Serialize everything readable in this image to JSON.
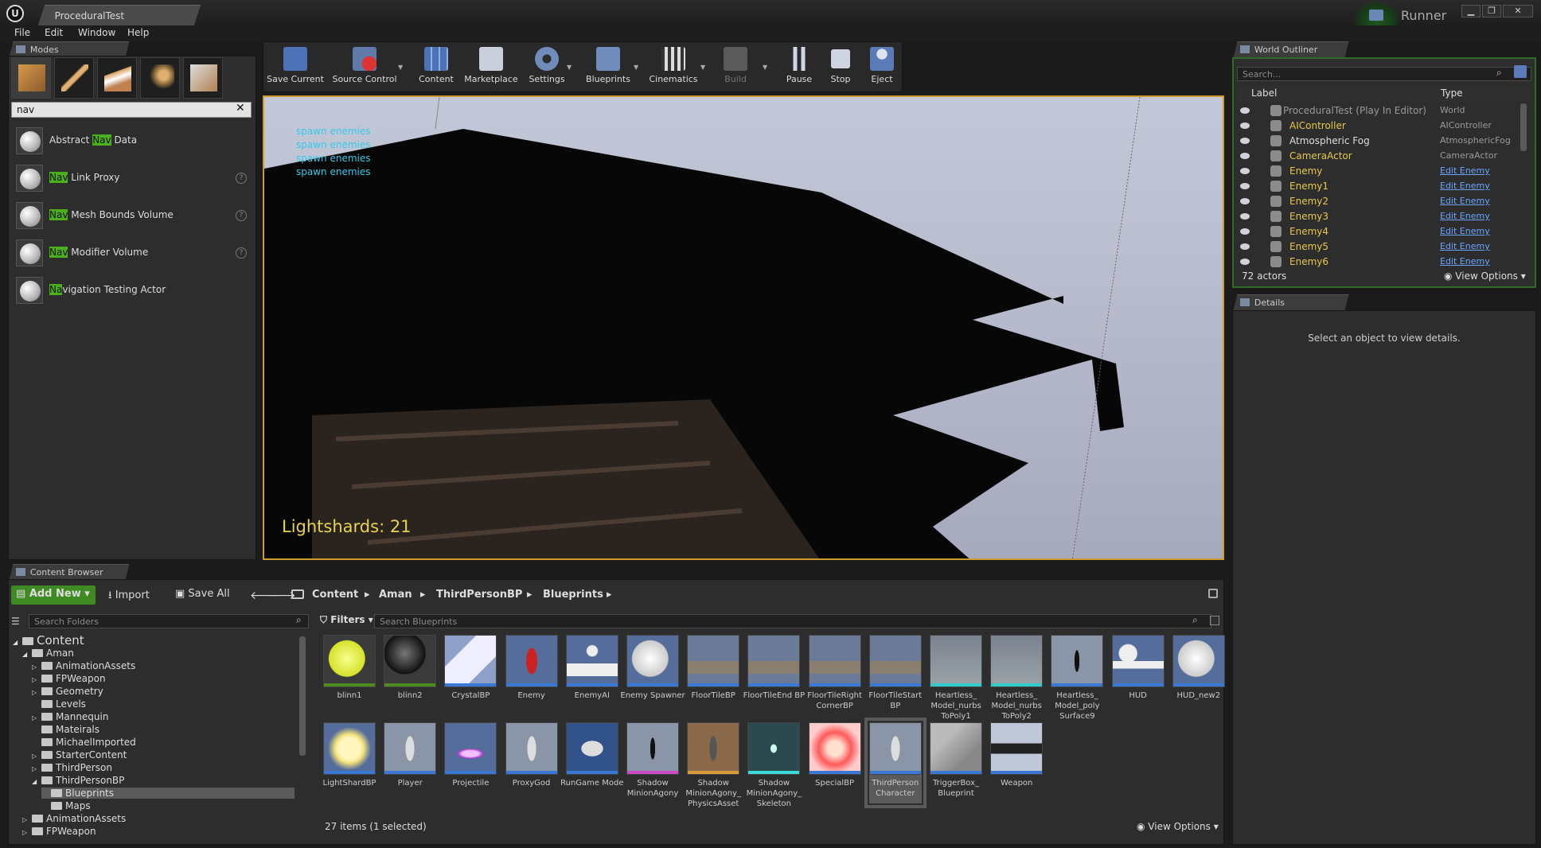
{
  "window": {
    "doc_tab": "ProceduralTest",
    "runner": "Runner",
    "min": "▁",
    "max": "❐",
    "close": "✕"
  },
  "menu": [
    "File",
    "Edit",
    "Window",
    "Help"
  ],
  "modes": {
    "tab": "Modes",
    "search": "nav",
    "actors": [
      {
        "prefix": "Abstract ",
        "hl": "Nav",
        "suffix": " Data",
        "help": false
      },
      {
        "prefix": "",
        "hl": "Nav",
        "suffix": " Link Proxy",
        "help": true
      },
      {
        "prefix": "",
        "hl": "Nav",
        "suffix": " Mesh Bounds Volume",
        "help": true
      },
      {
        "prefix": "",
        "hl": "Nav",
        "suffix": " Modifier Volume",
        "help": true
      },
      {
        "prefix": "",
        "hl": "Na",
        "suffix": "vigation Testing Actor",
        "help": false
      }
    ]
  },
  "toolbar": {
    "save_current": "Save Current",
    "source_control": "Source Control",
    "content": "Content",
    "marketplace": "Marketplace",
    "settings": "Settings",
    "blueprints": "Blueprints",
    "cinematics": "Cinematics",
    "build": "Build",
    "pause": "Pause",
    "stop": "Stop",
    "eject": "Eject"
  },
  "viewport": {
    "messages": [
      "spawn enemies",
      "spawn enemies",
      "spawn enemies",
      "spawn enemies"
    ],
    "hud": "Lightshards: 21"
  },
  "outliner": {
    "tab": "World Outliner",
    "search_placeholder": "Search...",
    "col_label": "Label",
    "col_type": "Type",
    "rows": [
      {
        "label": "ProceduralTest (Play In Editor)",
        "type": "World",
        "link": false,
        "dim": true
      },
      {
        "label": "AIController",
        "type": "AIController",
        "link": false,
        "dim": false
      },
      {
        "label": "Atmospheric Fog",
        "type": "AtmosphericFog",
        "link": false,
        "dim": false
      },
      {
        "label": "CameraActor",
        "type": "CameraActor",
        "link": false,
        "dim": false
      },
      {
        "label": "Enemy",
        "type": "Edit Enemy",
        "link": true,
        "dim": false
      },
      {
        "label": "Enemy1",
        "type": "Edit Enemy",
        "link": true,
        "dim": false
      },
      {
        "label": "Enemy2",
        "type": "Edit Enemy",
        "link": true,
        "dim": false
      },
      {
        "label": "Enemy3",
        "type": "Edit Enemy",
        "link": true,
        "dim": false
      },
      {
        "label": "Enemy4",
        "type": "Edit Enemy",
        "link": true,
        "dim": false
      },
      {
        "label": "Enemy5",
        "type": "Edit Enemy",
        "link": true,
        "dim": false
      },
      {
        "label": "Enemy6",
        "type": "Edit Enemy",
        "link": true,
        "dim": false
      }
    ],
    "count": "72 actors",
    "view_options": "View Options"
  },
  "details": {
    "tab": "Details",
    "empty": "Select an object to view details."
  },
  "content_browser": {
    "tab": "Content Browser",
    "add_new": "Add New",
    "import": "Import",
    "save_all": "Save All",
    "breadcrumbs": [
      "Content",
      "Aman",
      "ThirdPersonBP",
      "Blueprints"
    ],
    "search_folders": "Search Folders",
    "filters": "Filters",
    "search_assets": "Search Blueprints",
    "tree": [
      {
        "label": "Content",
        "depth": 0,
        "arrow": "◢"
      },
      {
        "label": "Aman",
        "depth": 1,
        "arrow": "◢"
      },
      {
        "label": "AnimationAssets",
        "depth": 2,
        "arrow": "▷"
      },
      {
        "label": "FPWeapon",
        "depth": 2,
        "arrow": "▷"
      },
      {
        "label": "Geometry",
        "depth": 2,
        "arrow": "▷"
      },
      {
        "label": "Levels",
        "depth": 2,
        "arrow": ""
      },
      {
        "label": "Mannequin",
        "depth": 2,
        "arrow": "▷"
      },
      {
        "label": "Mateirals",
        "depth": 2,
        "arrow": ""
      },
      {
        "label": "MichaelImported",
        "depth": 2,
        "arrow": ""
      },
      {
        "label": "StarterContent",
        "depth": 2,
        "arrow": "▷"
      },
      {
        "label": "ThirdPerson",
        "depth": 2,
        "arrow": "▷"
      },
      {
        "label": "ThirdPersonBP",
        "depth": 2,
        "arrow": "◢"
      },
      {
        "label": "Blueprints",
        "depth": 3,
        "arrow": "",
        "selected": true
      },
      {
        "label": "Maps",
        "depth": 3,
        "arrow": ""
      },
      {
        "label": "AnimationAssets",
        "depth": 1,
        "arrow": "▷"
      },
      {
        "label": "FPWeapon",
        "depth": 1,
        "arrow": "▷"
      }
    ],
    "assets": [
      {
        "name": "blinn1",
        "kind": "yellow",
        "stripe": "#4f8c1e"
      },
      {
        "name": "blinn2",
        "kind": "black",
        "stripe": "#4f8c1e"
      },
      {
        "name": "CrystalBP",
        "kind": "cube",
        "stripe": "#3a78d6"
      },
      {
        "name": "Enemy",
        "kind": "enemy",
        "stripe": "#3a78d6"
      },
      {
        "name": "EnemyAI",
        "kind": "pawn",
        "stripe": "#3a78d6"
      },
      {
        "name": "Enemy Spawner",
        "kind": "white",
        "stripe": "#3a78d6"
      },
      {
        "name": "FloorTileBP",
        "kind": "floor",
        "stripe": "#3a78d6"
      },
      {
        "name": "FloorTileEnd BP",
        "kind": "floor",
        "stripe": "#3a78d6"
      },
      {
        "name": "FloorTileRight CornerBP",
        "kind": "floor",
        "stripe": "#3a78d6"
      },
      {
        "name": "FloorTileStart BP",
        "kind": "floor",
        "stripe": "#3a78d6"
      },
      {
        "name": "Heartless_ Model_nurbs ToPoly1",
        "kind": "mesh",
        "stripe": "#31c9c9"
      },
      {
        "name": "Heartless_ Model_nurbs ToPoly2",
        "kind": "mesh",
        "stripe": "#31c9c9"
      },
      {
        "name": "Heartless_ Model_poly Surface9",
        "kind": "fig",
        "stripe": "#3a78d6"
      },
      {
        "name": "HUD",
        "kind": "hud",
        "stripe": "#3a78d6"
      },
      {
        "name": "HUD_new2",
        "kind": "white",
        "stripe": "#3a78d6"
      },
      {
        "name": "LightShardBP",
        "kind": "shard",
        "stripe": "#3a78d6"
      },
      {
        "name": "Player",
        "kind": "mannequin",
        "stripe": "#3a78d6"
      },
      {
        "name": "Projectile",
        "kind": "disc",
        "stripe": "#3a78d6"
      },
      {
        "name": "ProxyGod",
        "kind": "mannequin",
        "stripe": "#3a78d6"
      },
      {
        "name": "RunGame Mode",
        "kind": "gamepad",
        "stripe": "#3a78d6"
      },
      {
        "name": "Shadow MinionAgony",
        "kind": "fig",
        "stripe": "#c84ac8"
      },
      {
        "name": "Shadow MinionAgony_ PhysicsAsset",
        "kind": "skel",
        "stripe": "#d89a3a"
      },
      {
        "name": "Shadow MinionAgony_ Skeleton",
        "kind": "skel2",
        "stripe": "#3ad8d8"
      },
      {
        "name": "SpecialBP",
        "kind": "red",
        "stripe": "#3a78d6"
      },
      {
        "name": "ThirdPerson Character",
        "kind": "mannequin",
        "stripe": "#3a78d6",
        "selected": true
      },
      {
        "name": "TriggerBox_ Blueprint",
        "kind": "box",
        "stripe": "#3a78d6"
      },
      {
        "name": "Weapon",
        "kind": "gun",
        "stripe": "#3a78d6"
      }
    ],
    "status": "27 items (1 selected)",
    "view_options": "View Options"
  }
}
